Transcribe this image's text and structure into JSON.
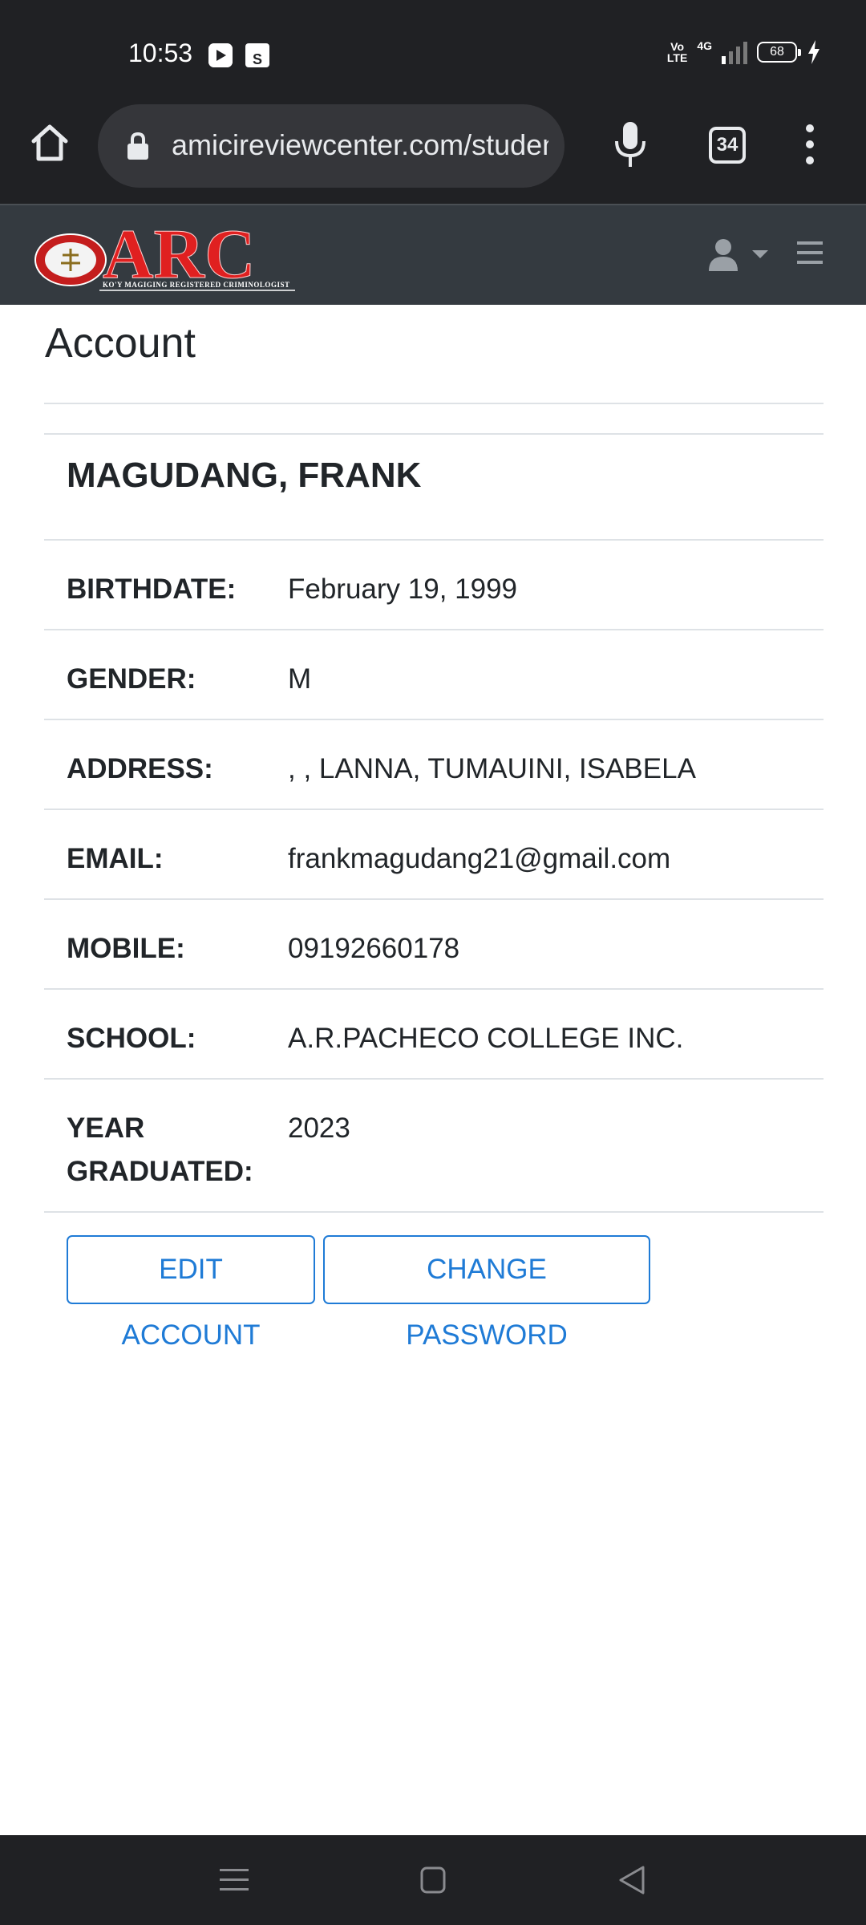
{
  "status_bar": {
    "time": "10:53",
    "network_label": "4G",
    "volte_label": "Vo\nLTE",
    "battery_level": "68"
  },
  "browser": {
    "url": "amicireviewcenter.com/student",
    "tab_count": "34",
    "icons": {
      "home": "home-icon",
      "lock": "lock-icon",
      "mic": "mic-icon",
      "menu": "more-vert-icon"
    }
  },
  "site_nav": {
    "logo_text": "ARC",
    "logo_subtitle": "KO'Y MAGIGING REGISTERED CRIMINOLOGIST",
    "icons": {
      "user": "user-icon",
      "hamburger": "hamburger-icon"
    }
  },
  "account": {
    "page_title": "Account",
    "student_name": "MAGUDANG, FRANK",
    "fields": [
      {
        "label": "BIRTHDATE:",
        "value": "February 19, 1999"
      },
      {
        "label": "GENDER:",
        "value": "M"
      },
      {
        "label": "ADDRESS:",
        "value": ", , LANNA, TUMAUINI, ISABELA"
      },
      {
        "label": "EMAIL:",
        "value": "frankmagudang21@gmail.com"
      },
      {
        "label": "MOBILE:",
        "value": "09192660178"
      },
      {
        "label": "SCHOOL:",
        "value": "A.R.PACHECO COLLEGE INC."
      },
      {
        "label_line1": "YEAR",
        "label_line2": "GRADUATED:",
        "value": "2023"
      }
    ],
    "buttons": {
      "edit": "EDIT ACCOUNT",
      "change_password": "CHANGE PASSWORD"
    },
    "colors": {
      "primary": "#1f7bd6",
      "navbar": "#343a40",
      "chrome": "#202124"
    }
  }
}
